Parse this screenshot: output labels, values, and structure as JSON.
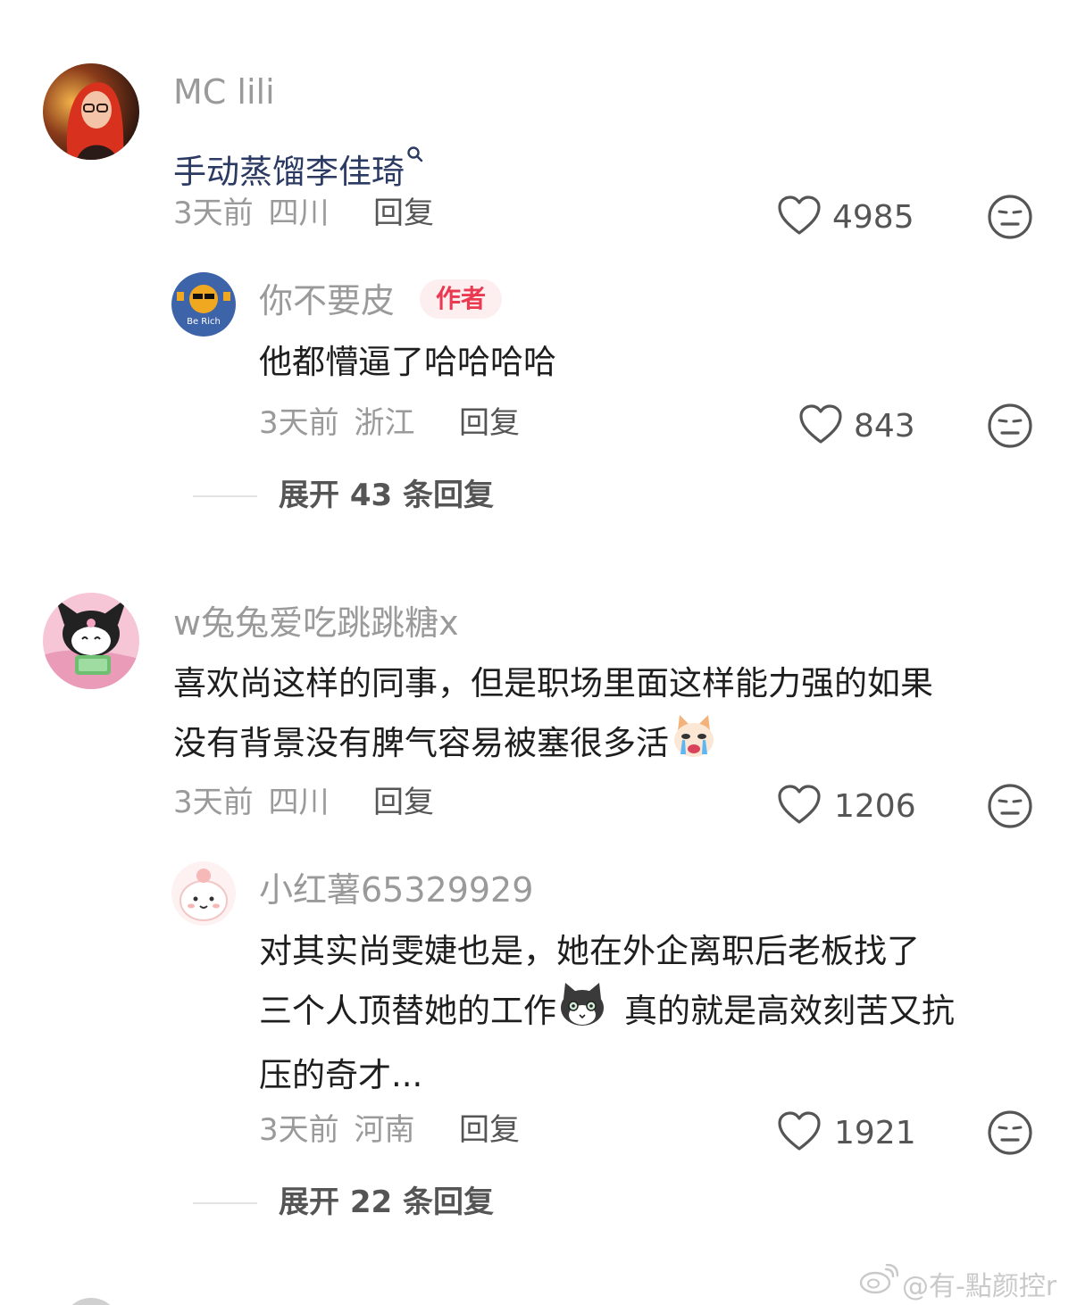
{
  "comments": [
    {
      "user": "MC lili",
      "text": "手动蒸馏李佳琦",
      "time": "3天前",
      "region": "四川",
      "reply_label": "回复",
      "likes": "4985",
      "replies": [
        {
          "user": "你不要皮",
          "badge": "作者",
          "avatar_text": "Be Rich",
          "text": "他都懵逼了哈哈哈哈",
          "time": "3天前",
          "region": "浙江",
          "reply_label": "回复",
          "likes": "843"
        }
      ],
      "expand_label": "展开 43 条回复"
    },
    {
      "user": "w兔兔爱吃跳跳糖x",
      "text_lines": [
        "喜欢尚这样的同事，但是职场里面这样能力强的如果",
        "没有背景没有脾气容易被塞很多活"
      ],
      "time": "3天前",
      "region": "四川",
      "reply_label": "回复",
      "likes": "1206",
      "replies": [
        {
          "user": "小红薯65329929",
          "text_lines": [
            "对其实尚雯婕也是，她在外企离职后老板找了",
            "三个人顶替她的工作",
            "真的就是高效刻苦又抗",
            "压的奇才..."
          ],
          "time": "3天前",
          "region": "河南",
          "reply_label": "回复",
          "likes": "1921"
        }
      ],
      "expand_label": "展开 22 条回复"
    }
  ],
  "watermark": "@有-點颜控r",
  "icons": {
    "like": "heart-outline-icon",
    "dislike": "meh-face-icon",
    "search": "search-icon",
    "weibo": "weibo-logo-icon"
  },
  "colors": {
    "link_text": "#2b3a63",
    "author_badge_bg": "#fdeef0",
    "author_badge_text": "#ea3a52",
    "meta_gray": "#9a9a9a"
  }
}
